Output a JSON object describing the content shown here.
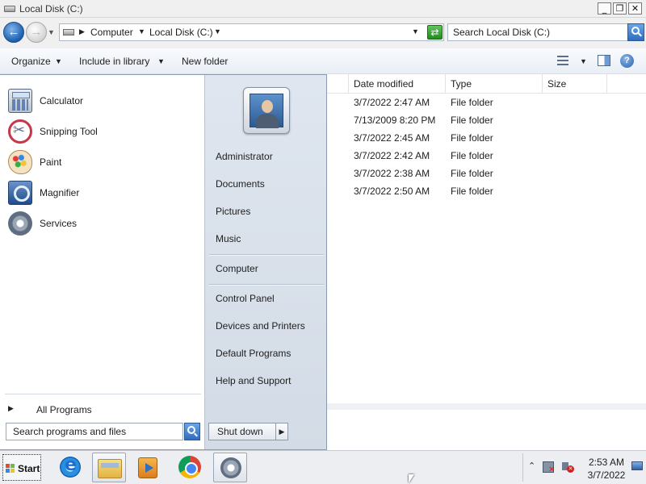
{
  "window": {
    "title": "Local Disk (C:)",
    "buttons": {
      "minimize": "_",
      "maximize": "❐",
      "close": "✕"
    }
  },
  "address": {
    "crumbs": [
      "Computer",
      "Local Disk (C:)"
    ],
    "search_placeholder": "Search Local Disk (C:)"
  },
  "toolbar": {
    "organize": "Organize",
    "include_in_library": "Include in library",
    "new_folder": "New folder"
  },
  "file_list": {
    "columns": [
      "Date modified",
      "Type",
      "Size"
    ],
    "rows": [
      {
        "date": "3/7/2022 2:47 AM",
        "type": "File folder"
      },
      {
        "date": "7/13/2009 8:20 PM",
        "type": "File folder"
      },
      {
        "date": "3/7/2022 2:45 AM",
        "type": "File folder"
      },
      {
        "date": "3/7/2022 2:42 AM",
        "type": "File folder"
      },
      {
        "date": "3/7/2022 2:38 AM",
        "type": "File folder"
      },
      {
        "date": "3/7/2022 2:50 AM",
        "type": "File folder"
      }
    ]
  },
  "start_menu": {
    "programs": [
      {
        "label": "Calculator",
        "icon": "calculator-icon"
      },
      {
        "label": "Snipping Tool",
        "icon": "snipping-tool-icon"
      },
      {
        "label": "Paint",
        "icon": "paint-icon"
      },
      {
        "label": "Magnifier",
        "icon": "magnifier-icon"
      },
      {
        "label": "Services",
        "icon": "services-icon"
      }
    ],
    "all_programs": "All Programs",
    "search_placeholder": "Search programs and files",
    "places_top": [
      "Administrator",
      "Documents",
      "Pictures",
      "Music"
    ],
    "places_mid": [
      "Computer"
    ],
    "places_bottom": [
      "Control Panel",
      "Devices and Printers",
      "Default Programs",
      "Help and Support"
    ],
    "shutdown": "Shut down"
  },
  "taskbar": {
    "start_label": "Start",
    "apps": [
      "internet-explorer-icon",
      "windows-explorer-icon",
      "media-player-icon",
      "chrome-icon",
      "services-icon"
    ],
    "time": "2:53 AM",
    "date": "3/7/2022"
  }
}
